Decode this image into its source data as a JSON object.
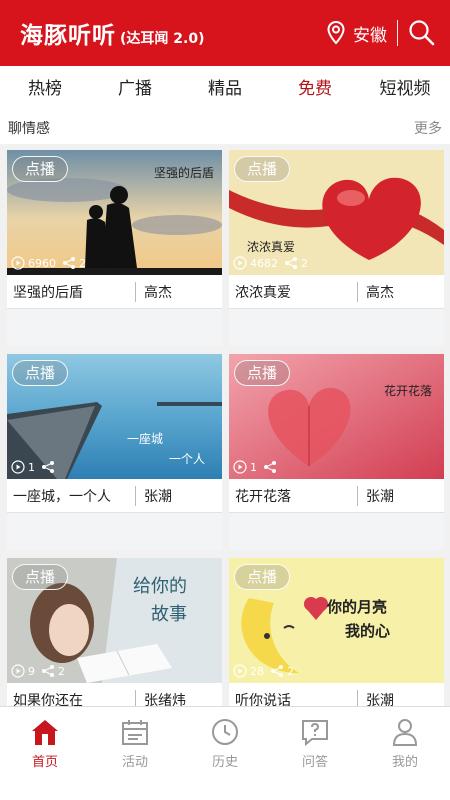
{
  "header": {
    "brand_name": "海豚听听",
    "brand_sub": "(达耳闻 2.0)",
    "location": "安徽",
    "location_icon": "location-pin-icon",
    "search_icon": "search-icon",
    "bg_color": "#d7141c"
  },
  "tabs": [
    {
      "label": "热榜"
    },
    {
      "label": "广播"
    },
    {
      "label": "精品"
    },
    {
      "label": "免费",
      "active": true
    },
    {
      "label": "短视频"
    }
  ],
  "section": {
    "title": "聊情感",
    "more": "更多"
  },
  "cards": [
    {
      "badge": "点播",
      "title": "坚强的后盾",
      "author": "高杰",
      "overlay": "坚强的后盾",
      "plays": "6960",
      "comments": "2"
    },
    {
      "badge": "点播",
      "title": "浓浓真爱",
      "author": "高杰",
      "overlay": "浓浓真爱",
      "plays": "4682",
      "comments": "2"
    },
    {
      "badge": "点播",
      "title": "一座城，一个人",
      "author": "张潮",
      "overlay_1": "一座城",
      "overlay_2": "一个人",
      "plays": "1",
      "comments": ""
    },
    {
      "badge": "点播",
      "title": "花开花落",
      "author": "张潮",
      "overlay": "花开花落",
      "plays": "1",
      "comments": ""
    },
    {
      "badge": "点播",
      "title": "如果你还在",
      "author": "张绪炜",
      "overlay_1": "给你的",
      "overlay_2": "故事",
      "plays": "9",
      "comments": "2"
    },
    {
      "badge": "点播",
      "title": "听你说话",
      "author": "张潮",
      "overlay_1": "你的月亮",
      "overlay_2": "我的心",
      "plays": "28",
      "comments": "2"
    }
  ],
  "bottom_nav": [
    {
      "label": "首页",
      "icon": "home-icon",
      "active": true
    },
    {
      "label": "活动",
      "icon": "calendar-icon"
    },
    {
      "label": "历史",
      "icon": "clock-icon"
    },
    {
      "label": "问答",
      "icon": "chat-question-icon"
    },
    {
      "label": "我的",
      "icon": "person-icon"
    }
  ],
  "colors": {
    "accent": "#c8161d",
    "inactive": "#999999"
  }
}
